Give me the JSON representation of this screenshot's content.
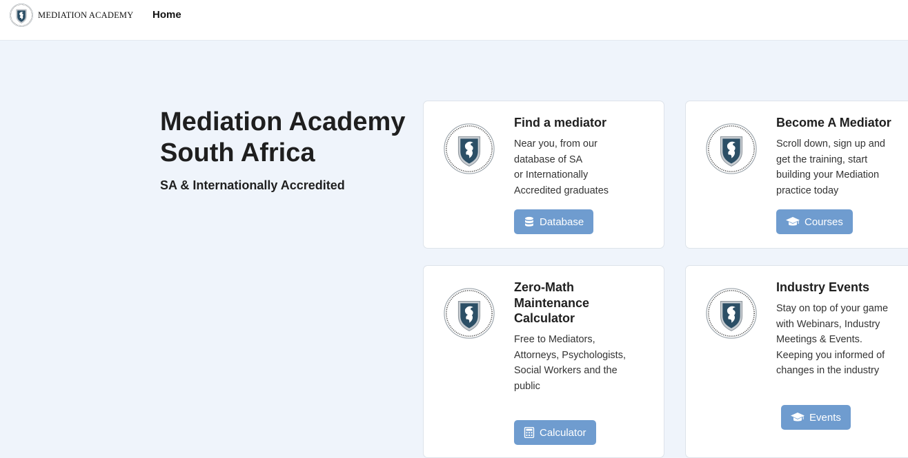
{
  "header": {
    "brand_name": "MEDIATION ACADEMY",
    "nav_home": "Home"
  },
  "hero": {
    "title": "Mediation Academy South Africa",
    "subtitle": "SA & Internationally Accredited"
  },
  "cards": [
    {
      "title": "Find a mediator",
      "lines": [
        "Near you, from our",
        "database of SA",
        "or Internationally",
        "Accredited graduates"
      ],
      "button": "Database",
      "icon": "database-icon"
    },
    {
      "title": "Become A Mediator",
      "lines": [
        "Scroll down, sign up and",
        "get the training, start",
        "building your Mediation",
        "practice today"
      ],
      "button": "Courses",
      "icon": "graduation-cap-icon"
    },
    {
      "title": "Zero-Math Maintenance Calculator",
      "lines": [
        "Free to Mediators,",
        "Attorneys, Psychologists,",
        "Social Workers and the",
        "public"
      ],
      "button": "Calculator",
      "icon": "calculator-icon"
    },
    {
      "title": "Industry Events",
      "lines": [
        "Stay on top of your game",
        "with Webinars, Industry",
        "Meetings & Events.",
        "Keeping you informed of",
        "changes in the industry"
      ],
      "button": "Events",
      "icon": "graduation-cap-icon"
    }
  ],
  "colors": {
    "page_background": "#eff4fb",
    "button": "#6f9ccf",
    "shield": "#2c4f66"
  }
}
